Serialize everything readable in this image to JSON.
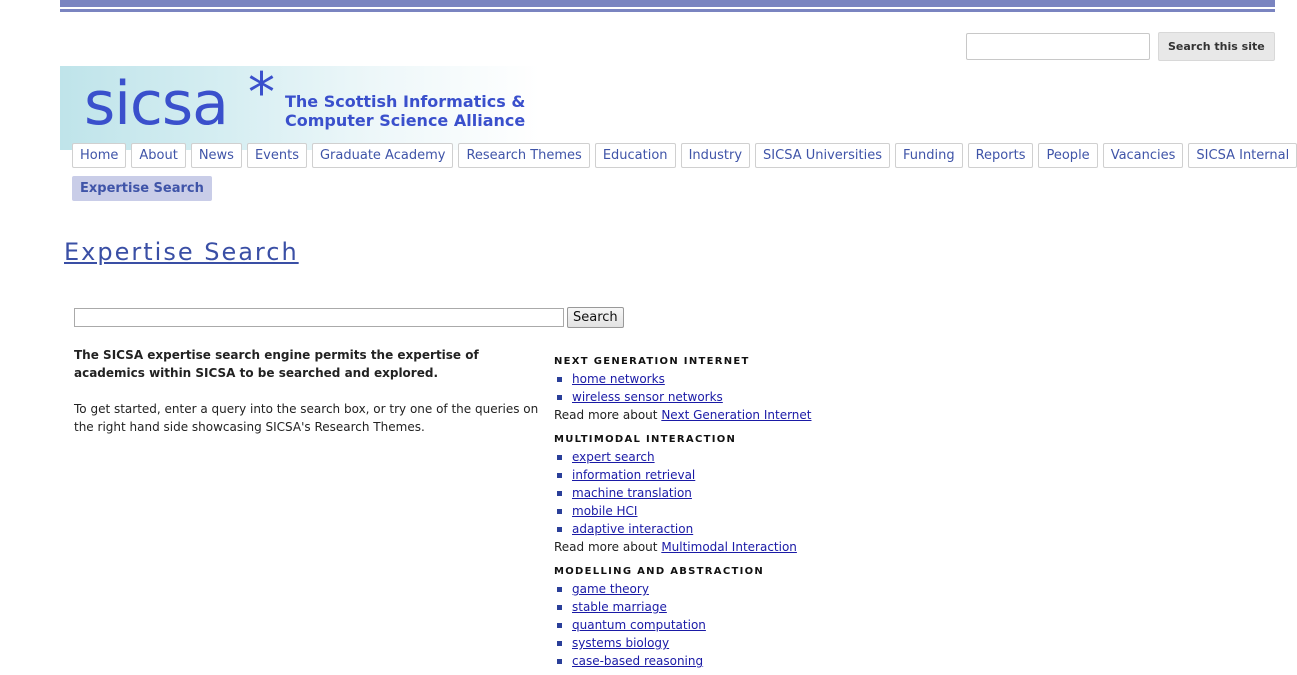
{
  "site_search": {
    "placeholder": "",
    "button_label": "Search this site"
  },
  "logo": {
    "word": "sicsa",
    "star": "*",
    "tagline_1": "The Scottish Informatics &",
    "tagline_2": "Computer Science Alliance"
  },
  "nav": {
    "items": [
      {
        "label": "Home"
      },
      {
        "label": "About"
      },
      {
        "label": "News"
      },
      {
        "label": "Events"
      },
      {
        "label": "Graduate Academy"
      },
      {
        "label": "Research Themes"
      },
      {
        "label": "Education"
      },
      {
        "label": "Industry"
      },
      {
        "label": "SICSA Universities"
      },
      {
        "label": "Funding"
      },
      {
        "label": "Reports"
      },
      {
        "label": "People"
      },
      {
        "label": "Vacancies"
      },
      {
        "label": "SICSA Internal"
      }
    ],
    "active_label": "Expertise Search"
  },
  "page": {
    "title": "Expertise Search"
  },
  "query": {
    "value": "",
    "button_label": "Search"
  },
  "intro": {
    "lead": "The SICSA expertise search engine permits the expertise of academics within SICSA to be searched and explored.",
    "body": "To get started, enter a query into the search box, or try one of the queries on the right hand side showcasing SICSA's Research Themes."
  },
  "themes": [
    {
      "heading": "NEXT GENERATION INTERNET",
      "queries": [
        "home networks",
        "wireless sensor networks"
      ],
      "readmore_prefix": "Read more about ",
      "readmore_link": "Next Generation Internet"
    },
    {
      "heading": "MULTIMODAL INTERACTION",
      "queries": [
        "expert search",
        "information retrieval",
        "machine translation",
        "mobile HCI",
        "adaptive interaction"
      ],
      "readmore_prefix": "Read more about ",
      "readmore_link": "Multimodal Interaction"
    },
    {
      "heading": "MODELLING AND ABSTRACTION",
      "queries": [
        "game theory",
        "stable marriage",
        "quantum computation",
        "systems biology",
        "case-based reasoning"
      ]
    }
  ]
}
